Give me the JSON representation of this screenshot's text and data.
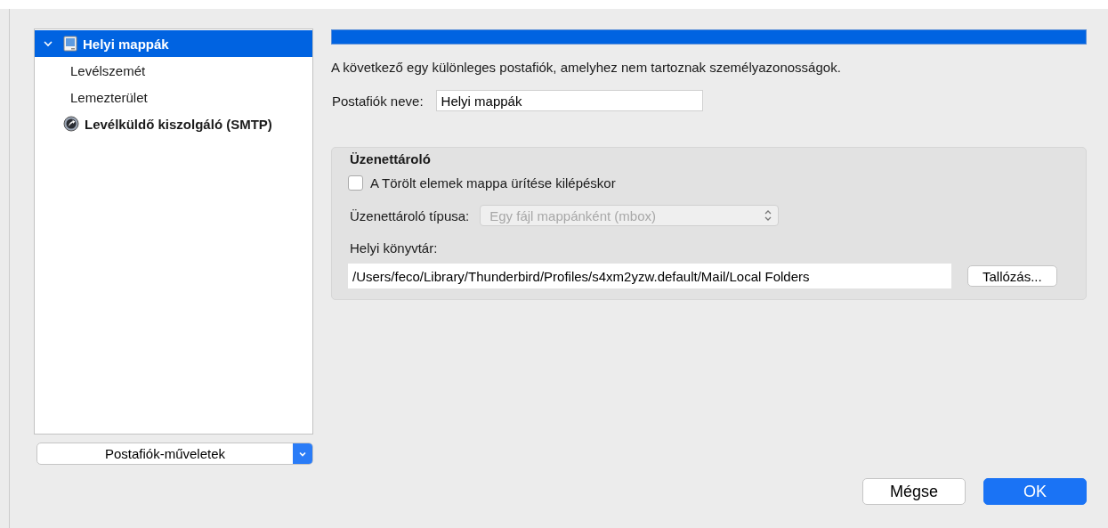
{
  "account_tree": [
    {
      "label": "Helyi mappák",
      "selected": true,
      "expanded": true,
      "kind": "local",
      "children": [
        {
          "label": "Levélszemét",
          "selected": false
        },
        {
          "label": "Lemezterület",
          "selected": false
        }
      ]
    },
    {
      "label": "Levélküldő kiszolgáló (SMTP)",
      "selected": false,
      "kind": "server"
    }
  ],
  "account_actions": {
    "label": "Postafiók-műveletek"
  },
  "description": "A következő egy különleges postafiók, amelyhez nem tartoznak személyazonosságok.",
  "account_name": {
    "label": "Postafiók neve:",
    "value": "Helyi mappák"
  },
  "message_store": {
    "title": "Üzenettároló",
    "empty_trash": {
      "label": "A Törölt elemek mappa ürítése kilépéskor",
      "checked": false
    },
    "store_type": {
      "label": "Üzenettároló típusa:",
      "value": "Egy fájl mappánként (mbox)",
      "disabled": true
    },
    "local_directory": {
      "label": "Helyi könyvtár:",
      "value": "/Users/feco/Library/Thunderbird/Profiles/s4xm2yzw.default/Mail/Local Folders",
      "browse": "Tallózás..."
    }
  },
  "buttons": [
    {
      "label": "Mégse",
      "kind": "default"
    },
    {
      "label": "OK",
      "kind": "primary"
    }
  ]
}
